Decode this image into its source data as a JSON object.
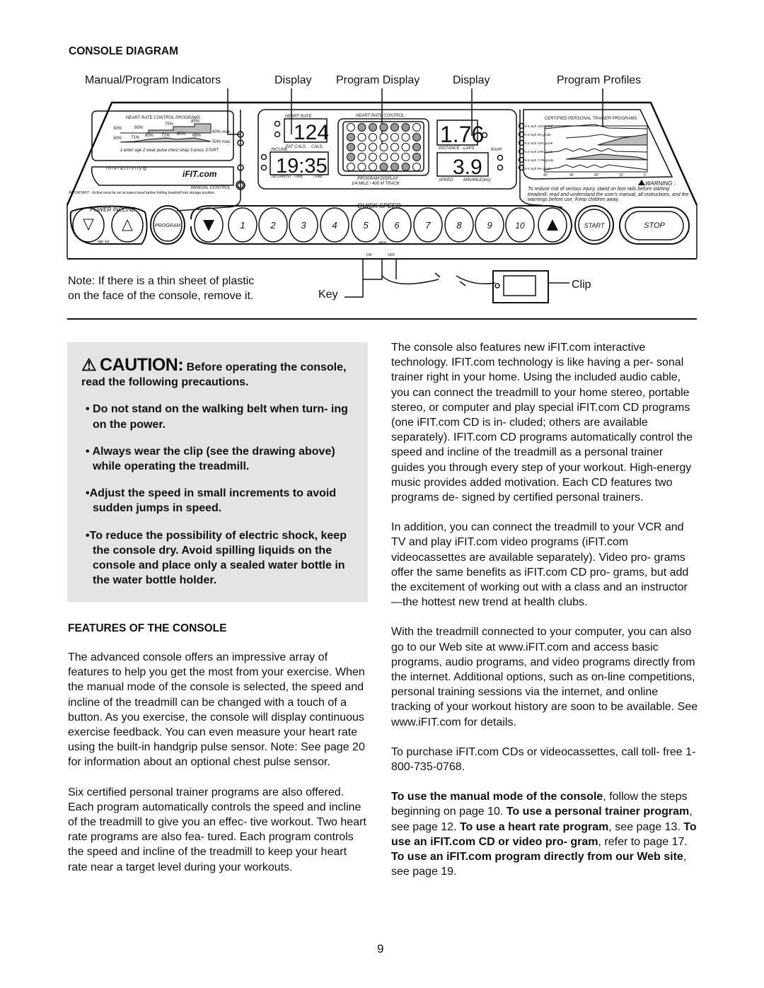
{
  "console_diagram": {
    "title": "CONSOLE DIAGRAM",
    "callouts": [
      "Manual/Program Indicators",
      "Display",
      "Program Display",
      "Display",
      "Program Profiles"
    ],
    "panel": {
      "hr_programs_title": "HEART RATE CONTROL PROGRAMS",
      "hr_prog1_labels": [
        "50%",
        "60%",
        "75%",
        "85%",
        "60% max."
      ],
      "hr_prog2_labels": [
        "50%",
        "71%",
        "80%",
        "71%",
        "80%",
        "68%",
        "50% max."
      ],
      "hr_steps": "1 enter age  2 wear pulse chest strap  3 press START",
      "interactivity": "i n t e r a c t i v i t y  @",
      "ifit_logo": "iFIT.com",
      "manual_control": "MANUAL CONTROL",
      "important": "IMPORTANT : Incline must be set at lowest level before folding treadmill into storage position.",
      "heart_rate_label": "HEART RATE",
      "heart_rate_value": "124",
      "fat_cals": "FAT CALS.",
      "cals": "CALS.",
      "incline_label": "INCLINE",
      "time_value": "19:35",
      "segment_time": "SEGMENT TIME",
      "time": "TIME",
      "hr_control": "HEART RATE CONTROL",
      "program_display": "PROGRAM DISPLAY",
      "track": "1/4 MILE / 400 M TRACK",
      "distance_value": "1.76",
      "distance": "DISTANCE",
      "laps": "LAPS",
      "kmh": "Km/H",
      "speed_value": "3.9",
      "speed": "SPEED",
      "min_mile": "MIN/MILE(km)",
      "trainer_title": "CERTIFIED PERSONAL TRAINER PROGRAMS",
      "trainer_programs": [
        "4.5 mph 10% grade",
        "5.0 mph 5% grade",
        "6.0 mph 10% grade",
        "6.0 mph 10% grade",
        "6.0 mph 7.5% grade",
        "6.0 mph 8% grade"
      ],
      "trainer_axis": [
        "40",
        "30",
        "20",
        "10",
        "0"
      ],
      "warning_title": "WARNING :",
      "warning_text": "To reduce risk of serious injury, stand on foot rails before starting treadmill, read and understand the user's manual, all instructions, and the warnings before use. Keep children away.",
      "power_incline": "POWER INCLINE",
      "age_set": "age set",
      "program_btn": "PROGRAM",
      "quick_speed": "QUICK SPEED",
      "speed_buttons": [
        "1",
        "2",
        "3",
        "4",
        "5",
        "6",
        "7",
        "8",
        "9",
        "10"
      ],
      "mph": "MPH",
      "start": "START",
      "stop": "STOP",
      "on": "ON",
      "off": "OFF"
    },
    "note": [
      "Note: If there is a thin sheet of plastic",
      "on the face of the console, remove it."
    ],
    "key_label": "Key",
    "clip_label": "Clip"
  },
  "caution": {
    "word": "CAUTION:",
    "lead": "Before operating the console, read the following precautions.",
    "items": [
      "Do not stand on the walking belt when turn- ing on the power.",
      "Always wear the clip (see the drawing above) while operating the treadmill.",
      "Adjust the speed in small increments to avoid sudden jumps in speed.",
      "To reduce the possibility of electric shock, keep the console dry. Avoid spilling liquids on the console and place only a sealed water bottle in the water bottle holder."
    ]
  },
  "features": {
    "title": "FEATURES OF THE CONSOLE",
    "left_paragraphs": [
      "The advanced console offers an impressive array of features to help you get the most from your exercise. When the manual mode of the console is selected, the speed and incline of the treadmill can be changed with a touch of a button. As you exercise, the console will display continuous exercise feedback. You can even measure your heart rate using the built-in handgrip pulse sensor. Note: See page 20 for information about an optional chest pulse sensor.",
      "Six certified personal trainer programs are also offered. Each program automatically controls the speed and incline of the treadmill to give you an effec- tive workout. Two heart rate programs are also fea- tured. Each program controls the speed and incline of the treadmill to keep your heart rate near a target level during your workouts."
    ],
    "right_paragraphs": [
      "The console also features new iFIT.com interactive technology. IFIT.com technology is like having a per- sonal trainer right in your home. Using the included audio cable, you can connect the treadmill to your home stereo, portable stereo, or computer and play special iFIT.com CD programs (one iFIT.com CD is in- cluded; others are available separately). IFIT.com CD programs automatically control the speed and incline of the treadmill as a personal trainer guides you through every step of your workout. High-energy music provides added motivation. Each CD features two programs de- signed by certified personal trainers.",
      "In addition, you can connect the treadmill to your VCR and TV and play iFIT.com video programs (iFIT.com videocassettes are available separately). Video pro- grams offer the same benefits as iFIT.com CD pro- grams, but add the excitement of working out with a class and an instructor—the hottest new trend at health clubs.",
      "With the treadmill connected to your computer, you can also go to our Web site at www.iFIT.com and access basic programs, audio programs, and video programs directly from the internet. Additional options, such as on-line competitions, personal training sessions via the internet, and online tracking of your workout history are soon to be available. See www.iFIT.com for details.",
      "To purchase iFIT.com CDs or videocassettes, call toll- free 1-800-735-0768."
    ],
    "final": [
      {
        "text": "To use the manual mode of the console",
        "bold": true
      },
      {
        "text": ", follow the steps beginning on page 10. ",
        "bold": false
      },
      {
        "text": "To use a personal trainer program",
        "bold": true
      },
      {
        "text": ", see page 12. ",
        "bold": false
      },
      {
        "text": "To use a heart rate program",
        "bold": true
      },
      {
        "text": ", see page 13. ",
        "bold": false
      },
      {
        "text": "To use an iFIT.com CD or video pro- gram",
        "bold": true
      },
      {
        "text": ", refer to page 17. ",
        "bold": false
      },
      {
        "text": "To use an iFIT.com program directly from our Web site",
        "bold": true
      },
      {
        "text": ", see page 19.",
        "bold": false
      }
    ]
  },
  "page_number": "9"
}
